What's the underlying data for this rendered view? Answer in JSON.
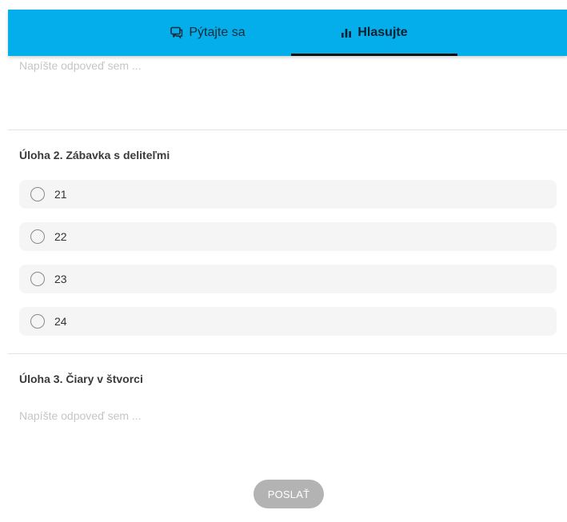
{
  "tabs": {
    "ask": {
      "label": "Pýtajte sa",
      "icon": "chat-bubbles-icon"
    },
    "vote": {
      "label": "Hlasujte",
      "icon": "bar-chart-icon"
    }
  },
  "question1": {
    "answer_placeholder": "Napíšte odpoveď sem ...",
    "answer_value": ""
  },
  "question2": {
    "title": "Úloha 2. Zábavka s deliteľmi",
    "options": [
      {
        "label": "21",
        "selected": false
      },
      {
        "label": "22",
        "selected": false
      },
      {
        "label": "23",
        "selected": false
      },
      {
        "label": "24",
        "selected": false
      }
    ]
  },
  "question3": {
    "title": "Úloha 3. Čiary v štvorci",
    "answer_placeholder": "Napíšte odpoveď sem ...",
    "answer_value": ""
  },
  "submit": {
    "label": "POSLAŤ"
  },
  "colors": {
    "header": "#03aeea",
    "active_tab_underline": "#0b0f12",
    "option_background": "#f5f5f5",
    "submit_disabled": "#b3b3b3"
  }
}
